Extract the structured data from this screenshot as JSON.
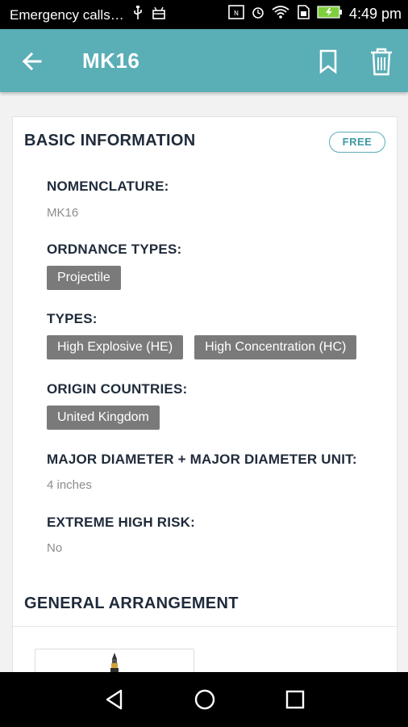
{
  "status_bar": {
    "carrier_text": "Emergency calls…",
    "time": "4:49 pm"
  },
  "app_bar": {
    "title": "MK16",
    "icons": [
      "arrow-left-icon",
      "bookmark-icon",
      "trash-icon"
    ]
  },
  "basic_info": {
    "section_title": "BASIC INFORMATION",
    "badge": "FREE",
    "nomenclature": {
      "label": "NOMENCLATURE:",
      "value": "MK16"
    },
    "ordnance_types": {
      "label": "ORDNANCE TYPES:",
      "chips": [
        "Projectile"
      ]
    },
    "types": {
      "label": "TYPES:",
      "chips": [
        "High Explosive (HE)",
        "High Concentration (HC)"
      ]
    },
    "origin_countries": {
      "label": "ORIGIN COUNTRIES:",
      "chips": [
        "United Kingdom"
      ]
    },
    "major_diameter": {
      "label": "MAJOR DIAMETER + MAJOR DIAMETER UNIT:",
      "value": "4 inches"
    },
    "extreme_high_risk": {
      "label": "EXTREME HIGH RISK:",
      "value": "No"
    }
  },
  "general_arrangement": {
    "section_title": "GENERAL ARRANGEMENT"
  },
  "colors": {
    "accent": "#5aaeb6",
    "chip_bg": "#7a7a7a",
    "heading": "#1f2b3a"
  },
  "nav_bar": {
    "icons": [
      "back-triangle-icon",
      "home-circle-icon",
      "recents-square-icon"
    ]
  }
}
